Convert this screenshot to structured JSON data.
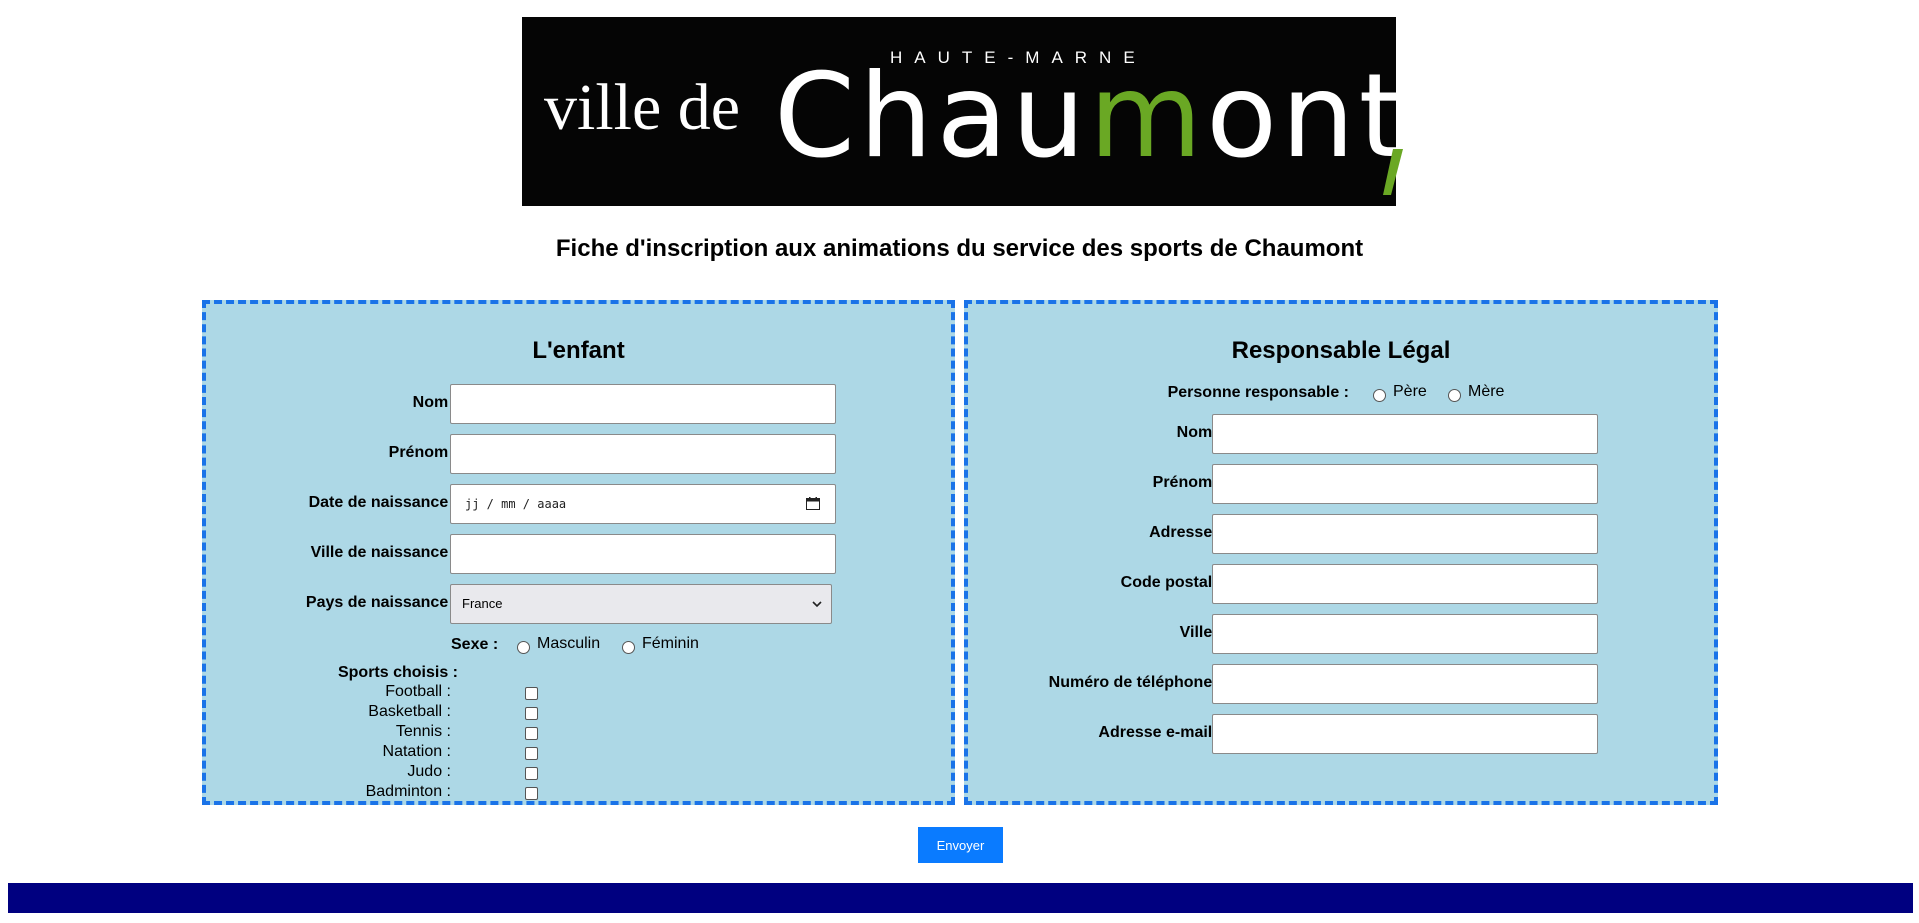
{
  "logo": {
    "region": "HAUTE-MARNE",
    "prefix": "ville de",
    "name_start": "Chau",
    "name_green": "m",
    "name_end": "ont",
    "accent_color": "#6aa824"
  },
  "title": "Fiche d'inscription aux animations du service des sports de Chaumont",
  "child": {
    "heading": "L'enfant",
    "nom_label": "Nom :",
    "prenom_label": "Prénom :",
    "date_label": "Date de naissance :",
    "date_placeholder": "jj / mm / aaaa",
    "ville_label": "Ville de naissance :",
    "pays_label": "Pays de naissance :",
    "pays_value": "France",
    "sexe_label": "Sexe :",
    "sexe_options": [
      "Masculin",
      "Féminin"
    ],
    "sports_label": "Sports choisis :",
    "sports": [
      "Football :",
      "Basketball :",
      "Tennis :",
      "Natation :",
      "Judo :",
      "Badminton :"
    ]
  },
  "guardian": {
    "heading": "Responsable Légal",
    "personne_label": "Personne responsable :",
    "personne_options": [
      "Père",
      "Mère"
    ],
    "nom_label": "Nom :",
    "prenom_label": "Prénom :",
    "adresse_label": "Adresse :",
    "cp_label": "Code postal :",
    "ville_label": "Ville :",
    "tel_label": "Numéro de téléphone :",
    "email_label": "Adresse e-mail :"
  },
  "submit_label": "Envoyer",
  "colors": {
    "panel_bg": "#add8e6",
    "panel_border": "#1a73e8",
    "button": "#0a7bff",
    "footer": "#000080"
  }
}
